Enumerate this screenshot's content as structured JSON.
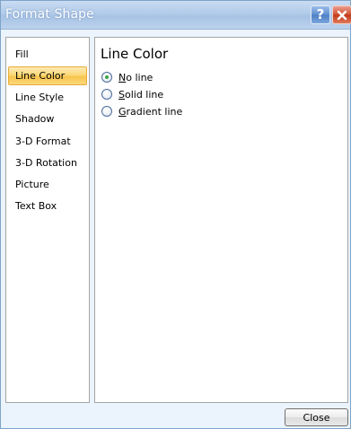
{
  "window": {
    "title": "Format Shape",
    "help_label": "?",
    "close_icon": "close-icon"
  },
  "nav": {
    "selected_index": 1,
    "items": [
      {
        "label": "Fill"
      },
      {
        "label": "Line Color"
      },
      {
        "label": "Line Style"
      },
      {
        "label": "Shadow"
      },
      {
        "label": "3-D Format"
      },
      {
        "label": "3-D Rotation"
      },
      {
        "label": "Picture"
      },
      {
        "label": "Text Box"
      }
    ]
  },
  "panel": {
    "title": "Line Color",
    "options": [
      {
        "mnemonic": "N",
        "rest": "o line",
        "checked": true
      },
      {
        "mnemonic": "S",
        "rest": "olid line",
        "checked": false
      },
      {
        "mnemonic": "G",
        "rest": "radient line",
        "checked": false
      }
    ]
  },
  "footer": {
    "close_label": "Close"
  },
  "colors": {
    "accent_selected": "#fbd978",
    "titlebar": "#b2cbe9",
    "radio_checked": "#3aa640"
  }
}
